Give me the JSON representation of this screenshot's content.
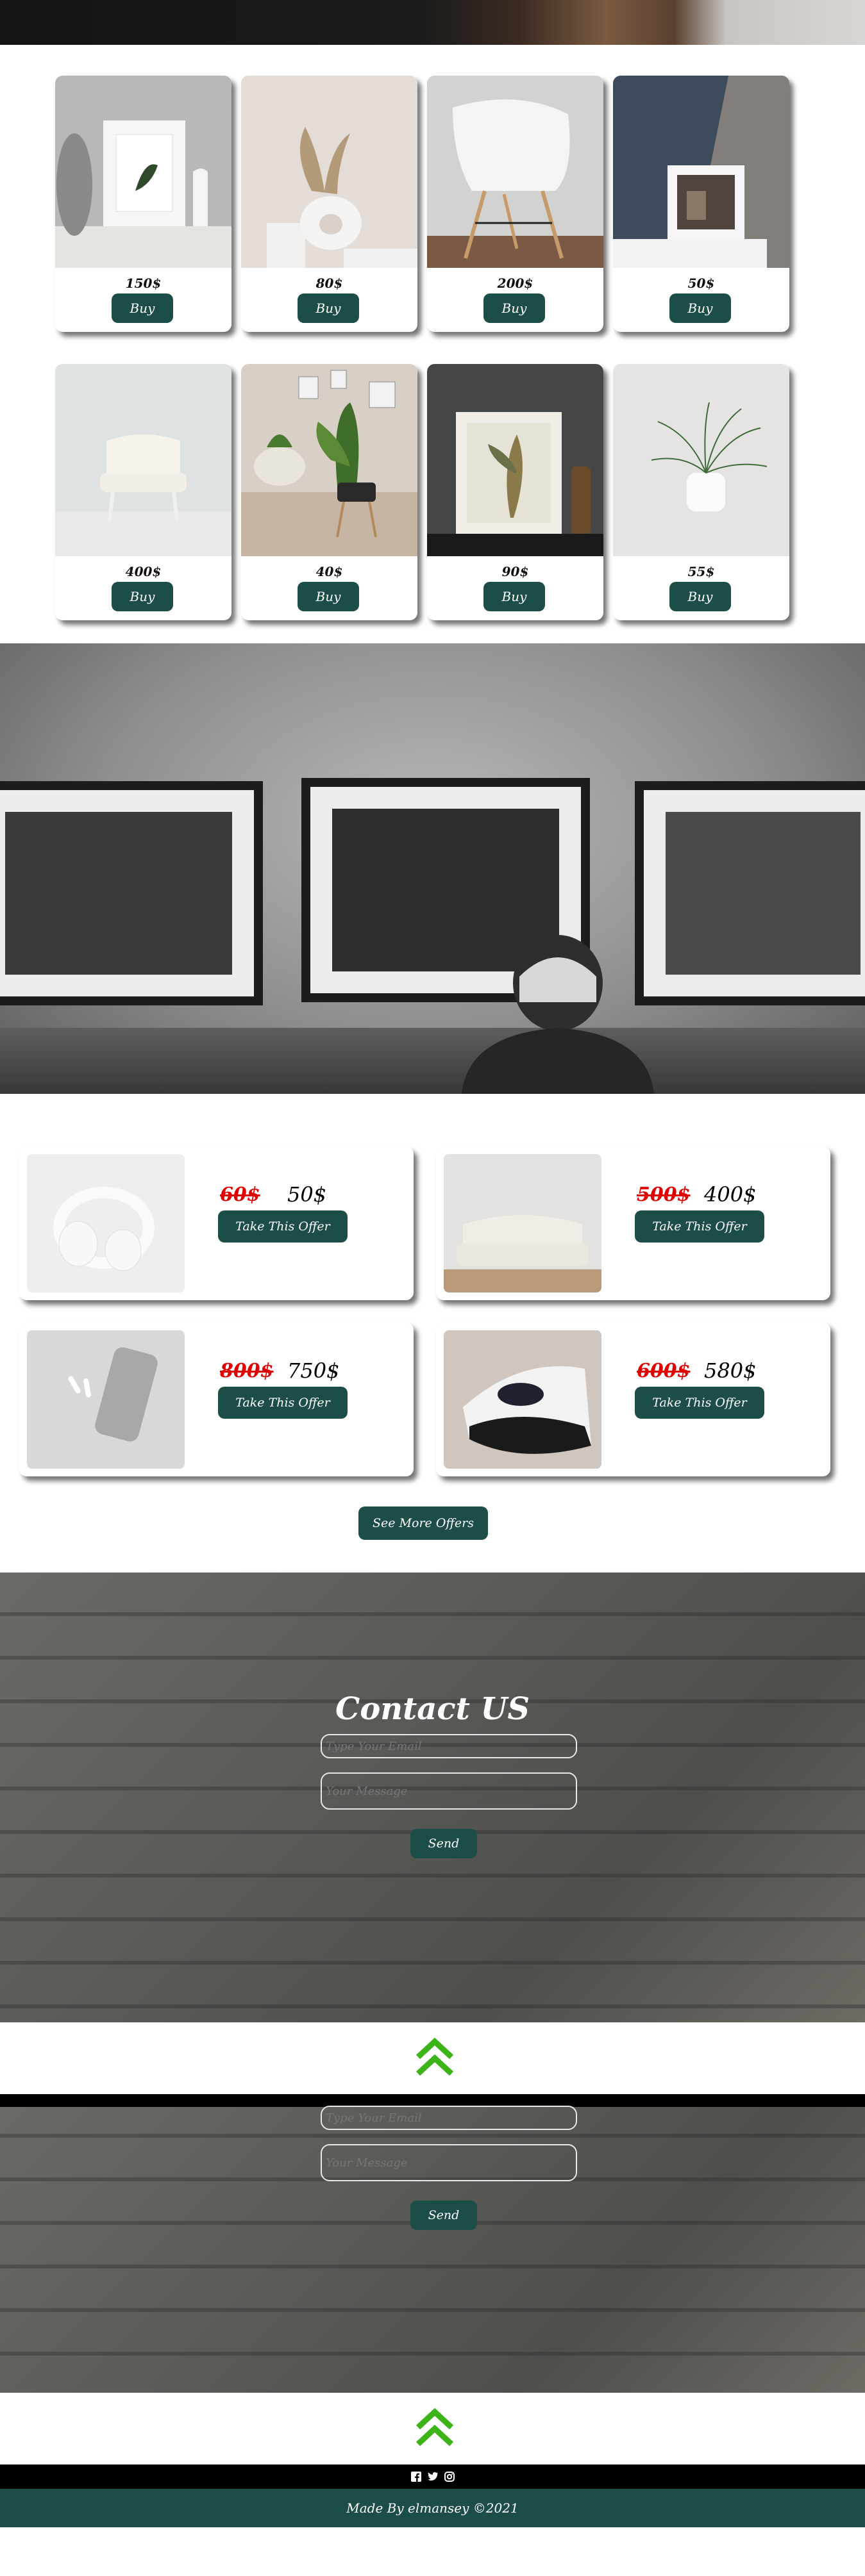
{
  "products": [
    {
      "price": "150$",
      "buy": "Buy",
      "image": "framed-plant-print"
    },
    {
      "price": "80$",
      "buy": "Buy",
      "image": "ring-vase-pampas"
    },
    {
      "price": "200$",
      "buy": "Buy",
      "image": "white-eames-chair"
    },
    {
      "price": "50$",
      "buy": "Buy",
      "image": "framed-street-photo"
    },
    {
      "price": "400$",
      "buy": "Buy",
      "image": "white-mini-armchair"
    },
    {
      "price": "40$",
      "buy": "Buy",
      "image": "potted-plant-stool"
    },
    {
      "price": "90$",
      "buy": "Buy",
      "image": "framed-dried-flower"
    },
    {
      "price": "55$",
      "buy": "Buy",
      "image": "white-pot-plant"
    }
  ],
  "offers": [
    {
      "old_price": "60$",
      "new_price": "50$",
      "button": "Take This Offer",
      "image": "white-headphones"
    },
    {
      "old_price": "500$",
      "new_price": "400$",
      "button": "Take This Offer",
      "image": "tufted-sofa"
    },
    {
      "old_price": "800$",
      "new_price": "750$",
      "button": "Take This Offer",
      "image": "phone-airpods"
    },
    {
      "old_price": "600$",
      "new_price": "580$",
      "button": "Take This Offer",
      "image": "game-console"
    }
  ],
  "more_offers": "See More Offers",
  "contact": {
    "title": "Contact US",
    "email_placeholder": "Type Your Email",
    "message_placeholder": "Your Message",
    "send": "Send"
  },
  "social_icons": [
    "facebook-icon",
    "twitter-icon",
    "instagram-icon"
  ],
  "footer": {
    "credit": "Made By elmansey ©2021"
  },
  "colors": {
    "accent": "#1c4e47",
    "old_price": "#e10000",
    "up_arrow": "#3cb317"
  }
}
